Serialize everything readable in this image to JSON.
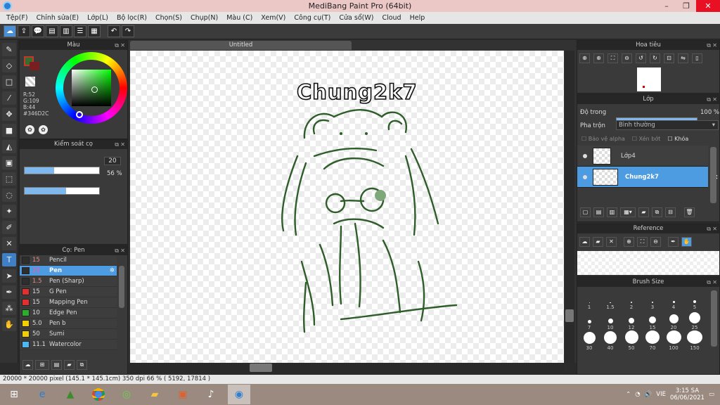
{
  "window": {
    "title": "MediBang Paint Pro (64bit)",
    "controls": [
      "–",
      "❐",
      "✕"
    ]
  },
  "menu": [
    "Tệp(F)",
    "Chỉnh sửa(E)",
    "Lớp(L)",
    "Bộ lọc(R)",
    "Chọn(S)",
    "Chụp(N)",
    "Màu (C)",
    "Xem(V)",
    "Công cụ(T)",
    "Cửa sổ(W)",
    "Cloud",
    "Help"
  ],
  "color_panel": {
    "title": "Màu",
    "r": "R:52",
    "g": "G:109",
    "b": "B:44",
    "hex": "#346D2C",
    "current_color": "#346D2C"
  },
  "brush_control": {
    "title": "Kiểm soát cọ",
    "size_value": "20",
    "size_fraction": 0.4,
    "opacity_value": "56 %",
    "opacity_fraction": 0.56
  },
  "brush_list": {
    "title": "Cọ: Pen",
    "items": [
      {
        "size": "15",
        "name": "Pencil",
        "color": "#2e2e2e"
      },
      {
        "size": "20",
        "name": "Pen",
        "color": "#2e2e2e",
        "selected": true
      },
      {
        "size": "1.5",
        "name": "Pen (Sharp)",
        "color": "#2e2e2e"
      },
      {
        "size": "15",
        "name": "G Pen",
        "color": "#e23030"
      },
      {
        "size": "15",
        "name": "Mapping Pen",
        "color": "#e23030"
      },
      {
        "size": "10",
        "name": "Edge Pen",
        "color": "#2cae2c"
      },
      {
        "size": "5.0",
        "name": " Pen b",
        "color": "#f0d000"
      },
      {
        "size": "50",
        "name": "Sumi",
        "color": "#f0d000"
      },
      {
        "size": "11.1",
        "name": "Watercolor",
        "color": "#4fb6f0"
      }
    ]
  },
  "canvas": {
    "tab": "Untitled",
    "text_art": "Chung2k7"
  },
  "navigator": {
    "title": "Hoa tiêu"
  },
  "layers": {
    "title": "Lớp",
    "opacity_label": "Độ trong",
    "opacity_value": "100 %",
    "opacity_fraction": 1.0,
    "blend_label": "Pha trộn",
    "blend_value": "Bình thường",
    "protect_alpha": "Bảo vệ alpha",
    "clipping": "Xén bớt",
    "lock": "Khóa",
    "items": [
      {
        "name": "Lớp4",
        "selected": false
      },
      {
        "name": "Chung2k7",
        "selected": true
      }
    ]
  },
  "reference": {
    "title": "Reference"
  },
  "brush_size": {
    "title": "Brush Size",
    "sizes": [
      "1",
      "1.5",
      "2",
      "3",
      "4",
      "5",
      "7",
      "10",
      "12",
      "15",
      "20",
      "25",
      "30",
      "40",
      "50",
      "70",
      "100",
      "150"
    ]
  },
  "status": {
    "text": "20000 * 20000 pixel  (145.1 * 145.1cm)   350 dpi   66 %   ( 5192, 17814 )"
  },
  "taskbar": {
    "time": "3:15 SA",
    "date": "06/06/2021",
    "lang": "VIE"
  }
}
